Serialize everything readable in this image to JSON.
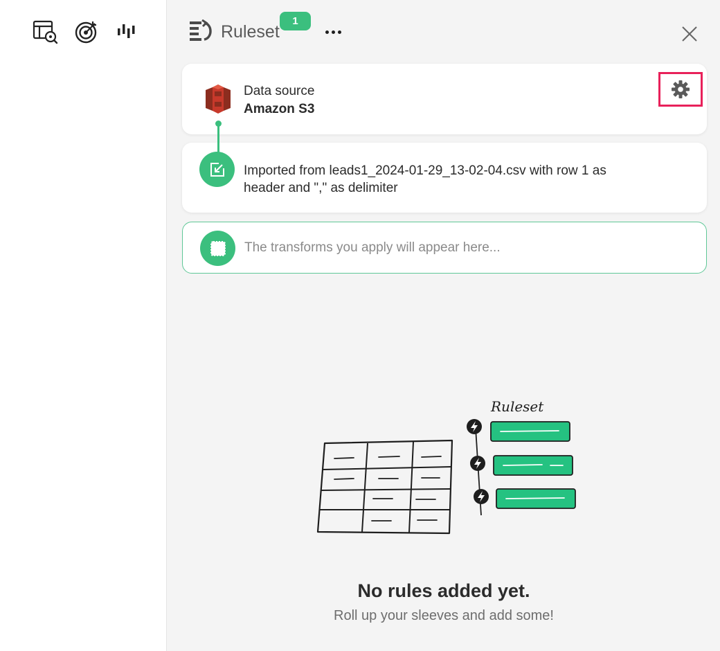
{
  "toolbar": {
    "icons": [
      "table-search-icon",
      "target-icon",
      "waveform-icon"
    ]
  },
  "panel": {
    "title": "Ruleset",
    "badge_count": "1",
    "source_card": {
      "label": "Data source",
      "value": "Amazon S3"
    },
    "import_card": {
      "text": "Imported from leads1_2024-01-29_13-02-04.csv with row 1 as header and \",\" as delimiter"
    },
    "transforms_card": {
      "placeholder": "The transforms you apply will appear here..."
    },
    "illustration": {
      "label": "Ruleset"
    },
    "empty_state": {
      "title": "No rules added yet.",
      "subtitle": "Roll up your sleeves and add some!"
    }
  },
  "colors": {
    "accent": "#3bbf7e",
    "highlight": "#e8215a",
    "panel_bg": "#f4f4f4",
    "s3_red": "#c7392b"
  }
}
